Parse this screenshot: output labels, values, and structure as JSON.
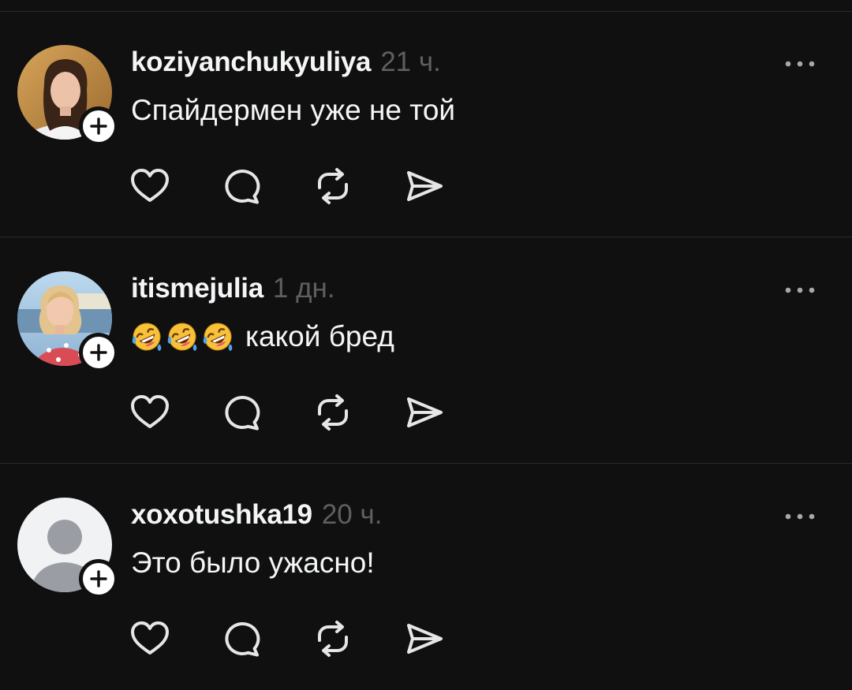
{
  "posts": [
    {
      "username": "koziyanchukyuliya",
      "time": "21 ч.",
      "text": "Спайдермен уже не той",
      "emoji": [],
      "avatar": "photo-woman-dark-hair"
    },
    {
      "username": "itismejulia",
      "time": "1 дн.",
      "text": "какой бред",
      "emoji": [
        "rolling-on-floor-laughing",
        "rolling-on-floor-laughing",
        "rolling-on-floor-laughing"
      ],
      "avatar": "photo-woman-blonde-seaside"
    },
    {
      "username": "xoxotushka19",
      "time": "20 ч.",
      "text": "Это было ужасно!",
      "emoji": [],
      "avatar": "default-avatar"
    }
  ],
  "actions": [
    "heart-icon",
    "comment-icon",
    "repost-icon",
    "share-icon"
  ],
  "colors": {
    "background": "#101010",
    "text": "#f3f5f7",
    "secondary": "#5f5f5f",
    "divider": "#2a2a2a",
    "icon": "#e6e6e6"
  }
}
